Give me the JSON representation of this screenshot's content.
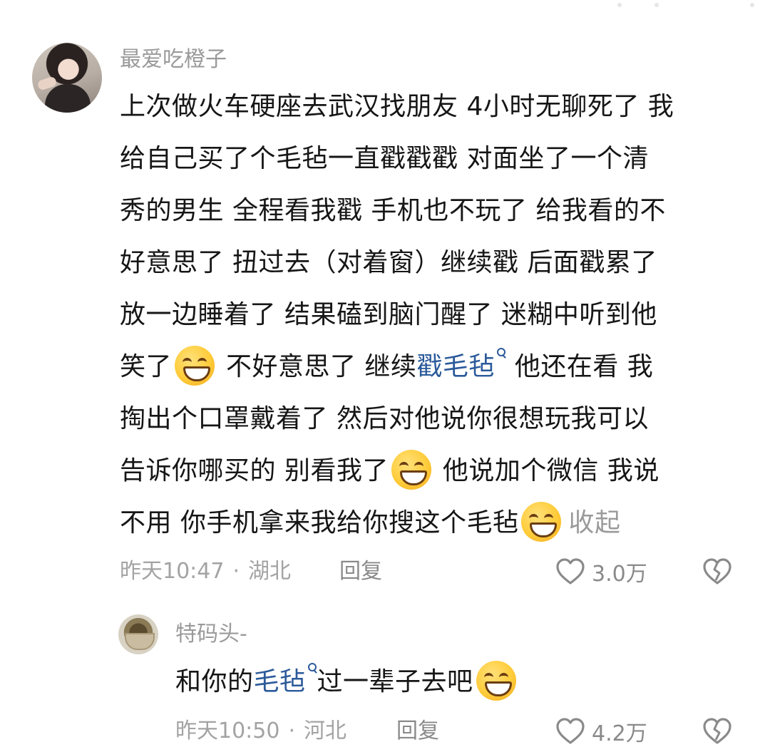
{
  "comments": [
    {
      "username": "最爱吃橙子",
      "lines": [
        [
          "上次做火车硬座去武汉找朋友 4小时无聊死了 我"
        ],
        [
          "给自己买了个毛毡一直戳戳戳 对面坐了一个清"
        ],
        [
          "秀的男生 全程看我戳 手机也不玩了 给我看的不"
        ],
        [
          "好意思了 扭过去（对着窗）继续戳  后面戳累了"
        ],
        [
          "放一边睡着了 结果磕到脑门醒了 迷糊中听到他"
        ],
        [
          "笑了",
          " 不好意思了 继续",
          "戳毛毡",
          " 他还在看 我"
        ],
        [
          "掏出个口罩戴着了 然后对他说你很想玩我可以"
        ],
        [
          "告诉你哪买的 别看我了",
          " 他说加个微信 我说"
        ],
        [
          "不用 你手机拿来我给你搜这个毛毡"
        ]
      ],
      "collapse_label": "收起",
      "time": "昨天10:47",
      "location": "湖北",
      "reply_label": "回复",
      "likes": "3.0万"
    },
    {
      "username": "特码头-",
      "text_before": "和你的",
      "link_text": "毛毡",
      "text_after": "过一辈子去吧",
      "time": "昨天10:50",
      "location": "河北",
      "reply_label": "回复",
      "likes": "4.2万"
    }
  ],
  "separator": "·",
  "icons": {
    "emoji": "grinning-face-icon",
    "like": "heart-icon",
    "dislike": "broken-heart-icon",
    "search": "search-icon"
  },
  "colors": {
    "text": "#161616",
    "muted": "#9a9a9a",
    "link": "#2b5a9a",
    "emoji": "#ffcc3a"
  }
}
